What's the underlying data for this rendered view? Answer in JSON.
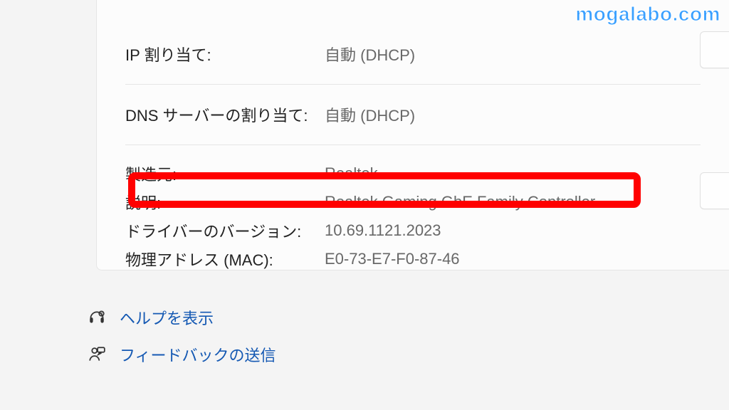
{
  "watermark": "mogalabo.com",
  "network": {
    "ip_assignment_label": "IP 割り当て:",
    "ip_assignment_value": "自動 (DHCP)",
    "dns_assignment_label": "DNS サーバーの割り当て:",
    "dns_assignment_value": "自動 (DHCP)",
    "manufacturer_label": "製造元:",
    "manufacturer_value": "Realtek",
    "description_label": "説明:",
    "description_value": "Realtek Gaming GbE Family Controller",
    "driver_version_label": "ドライバーのバージョン:",
    "driver_version_value": "10.69.1121.2023",
    "mac_label": "物理アドレス (MAC):",
    "mac_value": "E0-73-E7-F0-87-46"
  },
  "links": {
    "help": "ヘルプを表示",
    "feedback": "フィードバックの送信"
  }
}
